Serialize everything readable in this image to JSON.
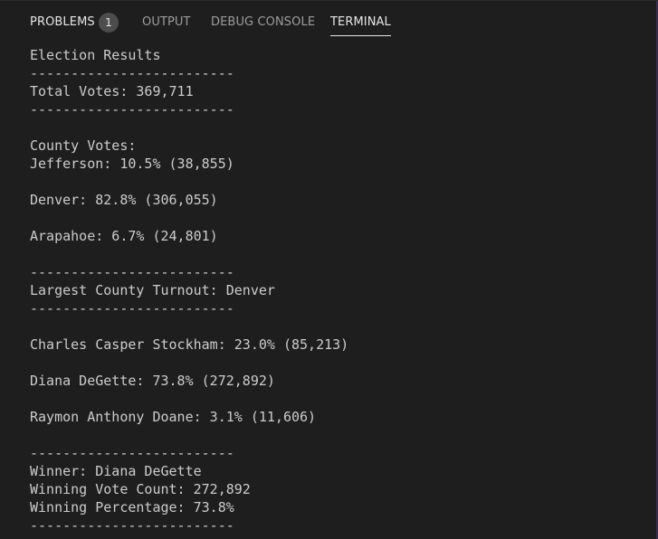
{
  "tabs": {
    "problems": "PROBLEMS",
    "problems_count": "1",
    "output": "OUTPUT",
    "debug_console": "DEBUG CONSOLE",
    "terminal": "TERMINAL"
  },
  "terminal": {
    "lines": [
      "Election Results",
      "-------------------------",
      "Total Votes: 369,711",
      "-------------------------",
      "",
      "County Votes:",
      "Jefferson: 10.5% (38,855)",
      "",
      "Denver: 82.8% (306,055)",
      "",
      "Arapahoe: 6.7% (24,801)",
      "",
      "-------------------------",
      "Largest County Turnout: Denver",
      "-------------------------",
      "",
      "Charles Casper Stockham: 23.0% (85,213)",
      "",
      "Diana DeGette: 73.8% (272,892)",
      "",
      "Raymon Anthony Doane: 3.1% (11,606)",
      "",
      "-------------------------",
      "Winner: Diana DeGette",
      "Winning Vote Count: 272,892",
      "Winning Percentage: 73.8%",
      "-------------------------"
    ]
  }
}
